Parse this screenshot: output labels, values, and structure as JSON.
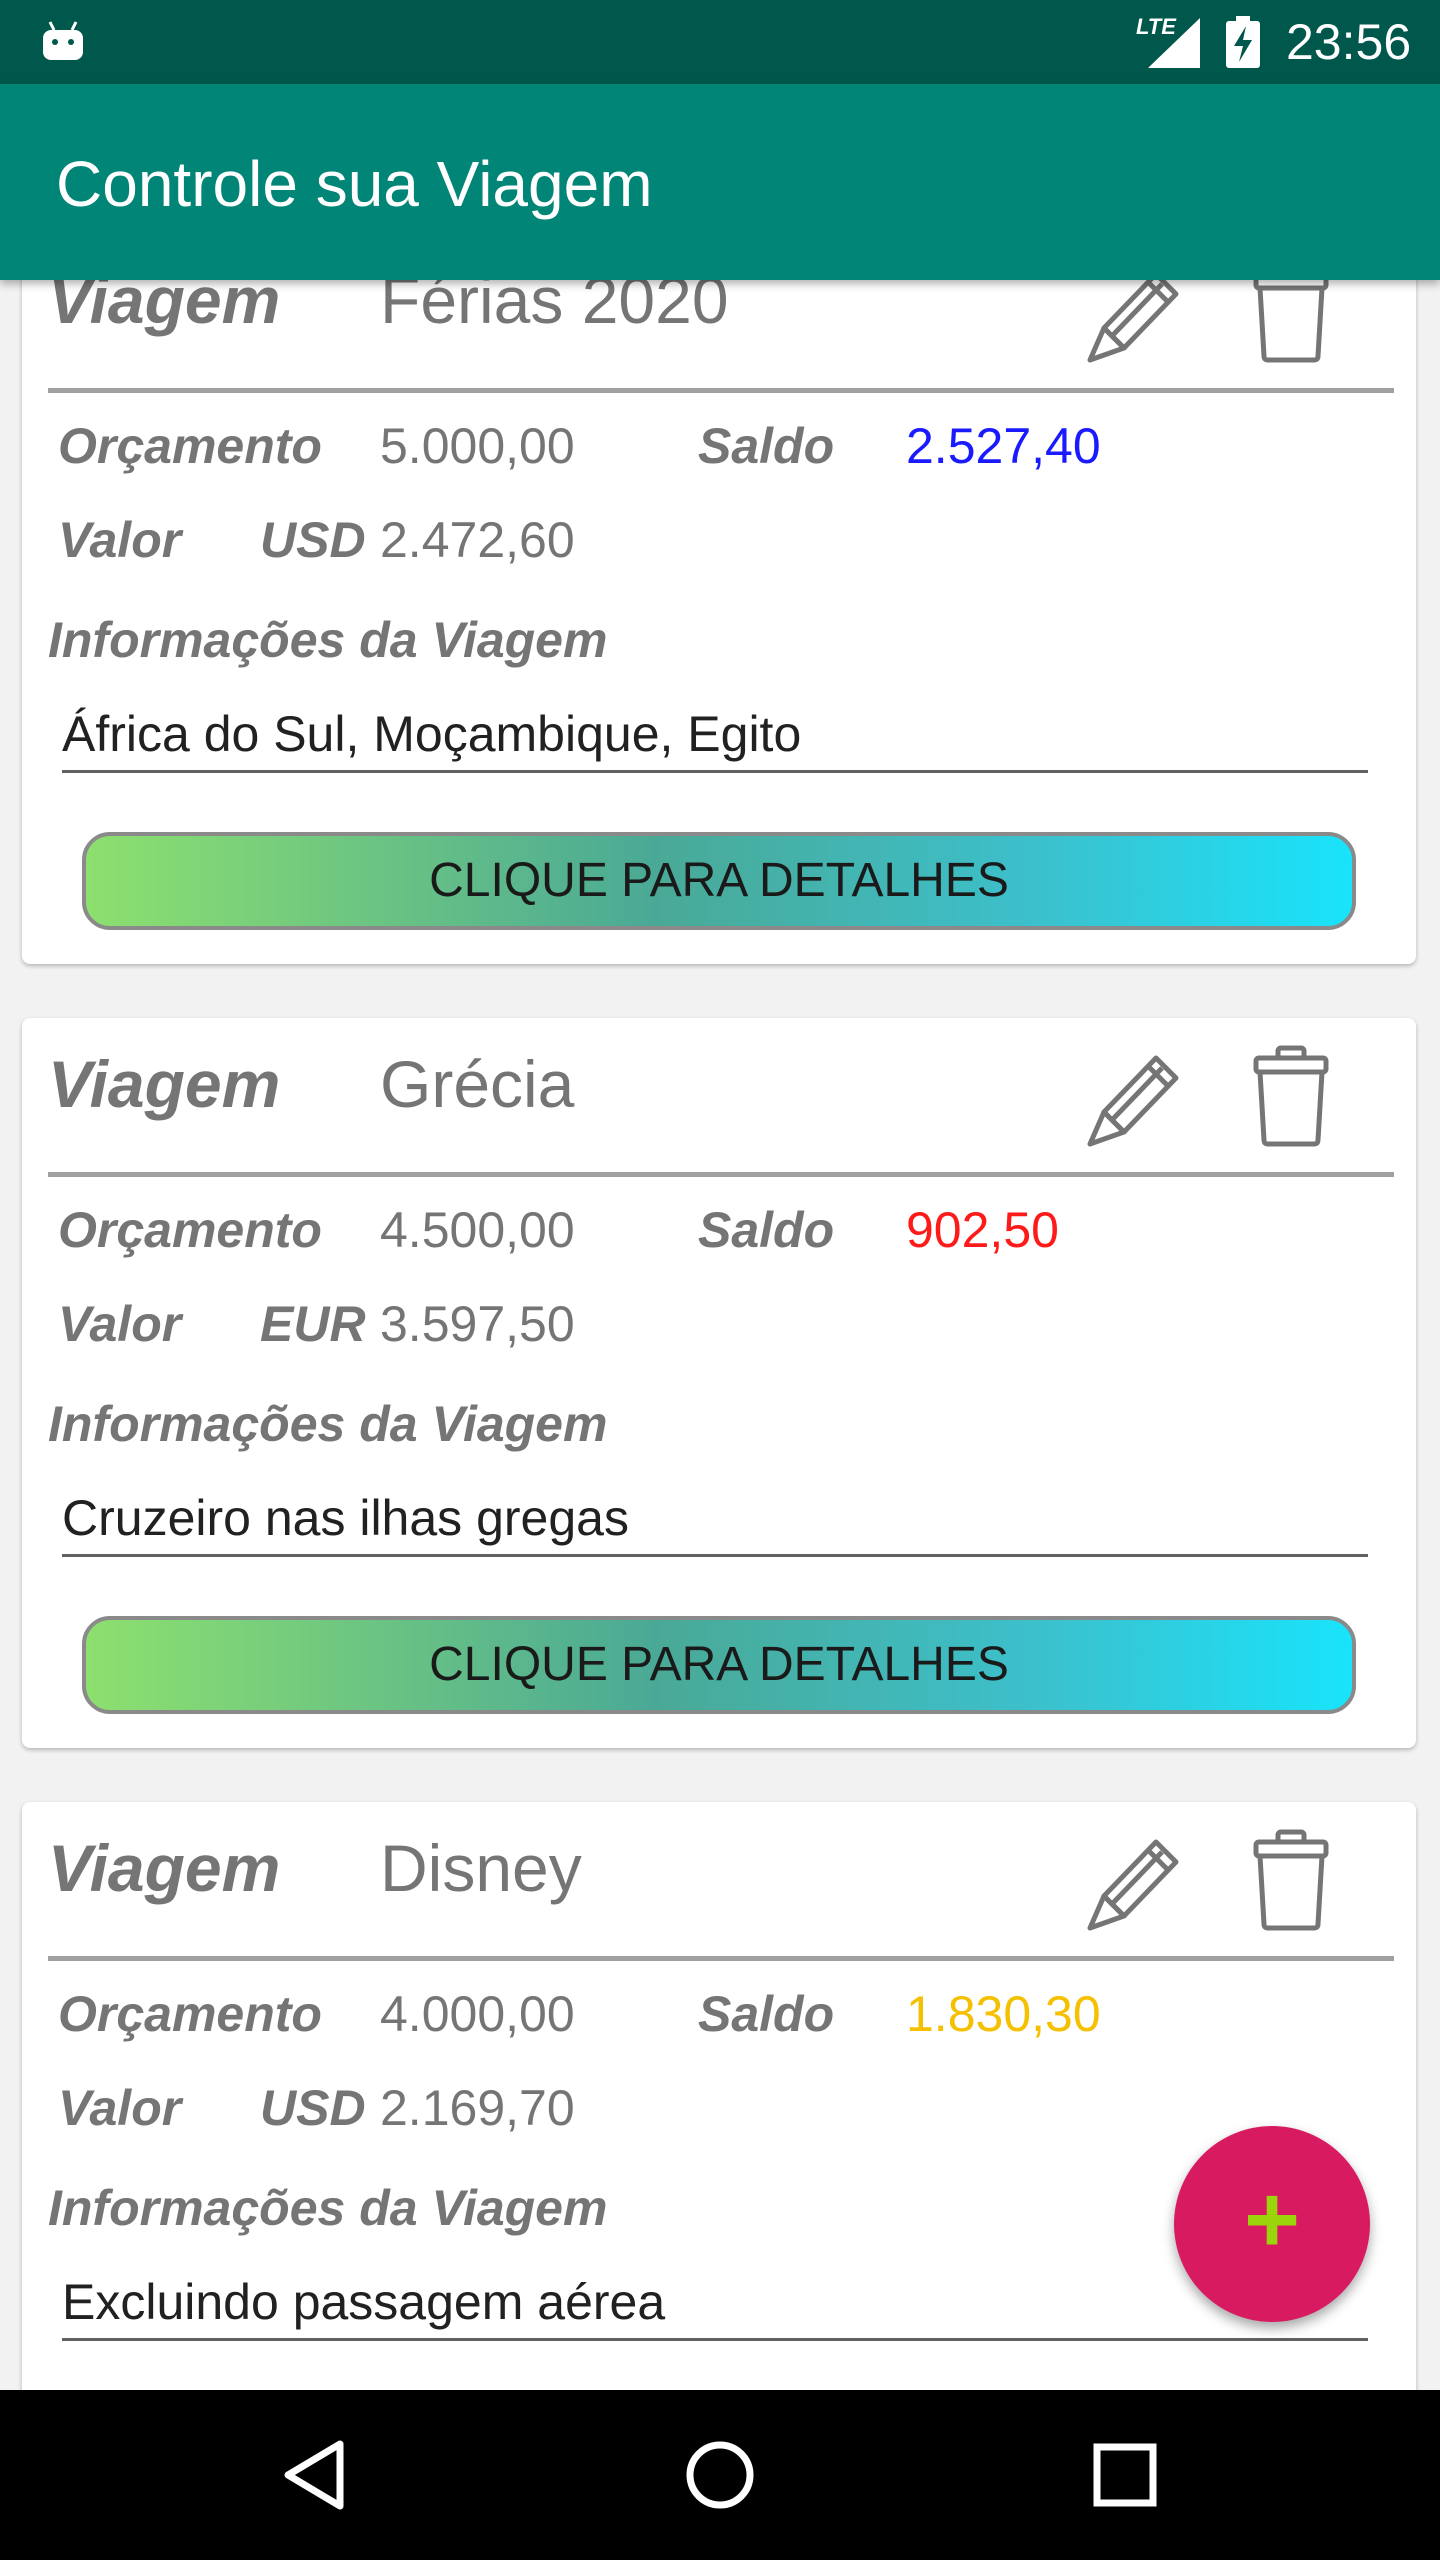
{
  "status_bar": {
    "network": "LTE",
    "time": "23:56"
  },
  "app_bar": {
    "title": "Controle sua Viagem"
  },
  "labels": {
    "trip": "Viagem",
    "budget": "Orçamento",
    "balance": "Saldo",
    "value": "Valor",
    "info": "Informações da Viagem",
    "details_button": "CLIQUE PARA DETALHES"
  },
  "trips": [
    {
      "name": "Férias 2020",
      "budget": "5.000,00",
      "balance": "2.527,40",
      "balance_color": "#1a1aff",
      "currency": "USD",
      "value": "2.472,60",
      "info": "África do Sul, Moçambique, Egito"
    },
    {
      "name": "Grécia",
      "budget": "4.500,00",
      "balance": "902,50",
      "balance_color": "#ff1a1a",
      "currency": "EUR",
      "value": "3.597,50",
      "info": "Cruzeiro nas ilhas gregas"
    },
    {
      "name": "Disney",
      "budget": "4.000,00",
      "balance": "1.830,30",
      "balance_color": "#f5c000",
      "currency": "USD",
      "value": "2.169,70",
      "info": "Excluindo passagem aérea"
    }
  ],
  "fab": {
    "label": "+"
  },
  "icons": {
    "edit": "pencil-icon",
    "delete": "trash-icon",
    "back": "back-triangle-icon",
    "home": "home-circle-icon",
    "recents": "recents-square-icon"
  }
}
